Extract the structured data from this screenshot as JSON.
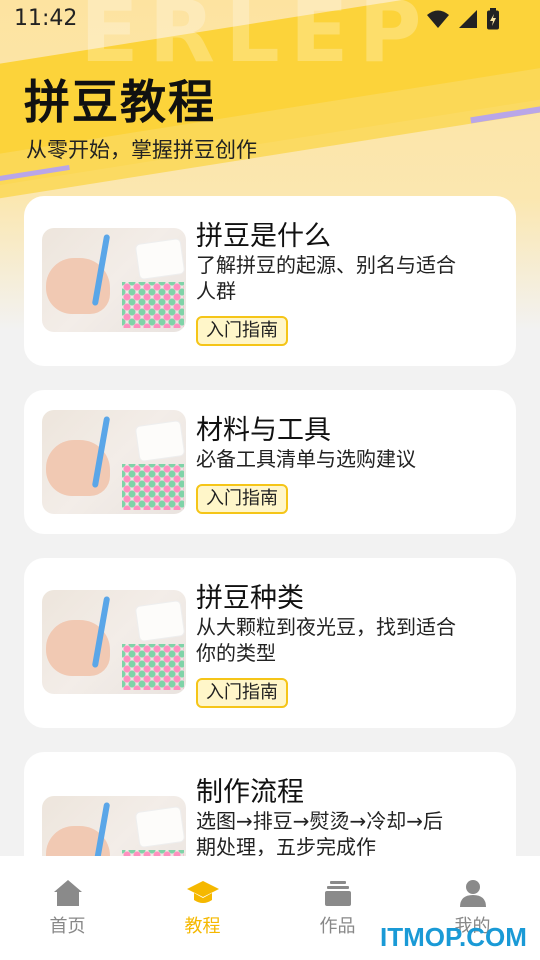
{
  "status": {
    "time": "11:42"
  },
  "header": {
    "title": "拼豆教程",
    "subtitle": "从零开始，掌握拼豆创作"
  },
  "cards": [
    {
      "title": "拼豆是什么",
      "desc": "了解拼豆的起源、别名与适合人群",
      "tag": "入门指南"
    },
    {
      "title": "材料与工具",
      "desc": "必备工具清单与选购建议",
      "tag": "入门指南"
    },
    {
      "title": "拼豆种类",
      "desc": "从大颗粒到夜光豆，找到适合你的类型",
      "tag": "入门指南"
    },
    {
      "title": "制作流程",
      "desc": "选图→排豆→熨烫→冷却→后期处理，五步完成作",
      "tag": ""
    }
  ],
  "nav": {
    "items": [
      {
        "label": "首页",
        "icon": "home-icon"
      },
      {
        "label": "教程",
        "icon": "graduation-cap-icon"
      },
      {
        "label": "作品",
        "icon": "stack-icon"
      },
      {
        "label": "我的",
        "icon": "user-icon"
      }
    ],
    "active_index": 1
  },
  "watermark": "ITMOP.COM",
  "colors": {
    "accent": "#f5b800",
    "tag_border": "#f5c518",
    "tag_bg": "#fff6c9",
    "header_yellow": "#fcd33a"
  }
}
